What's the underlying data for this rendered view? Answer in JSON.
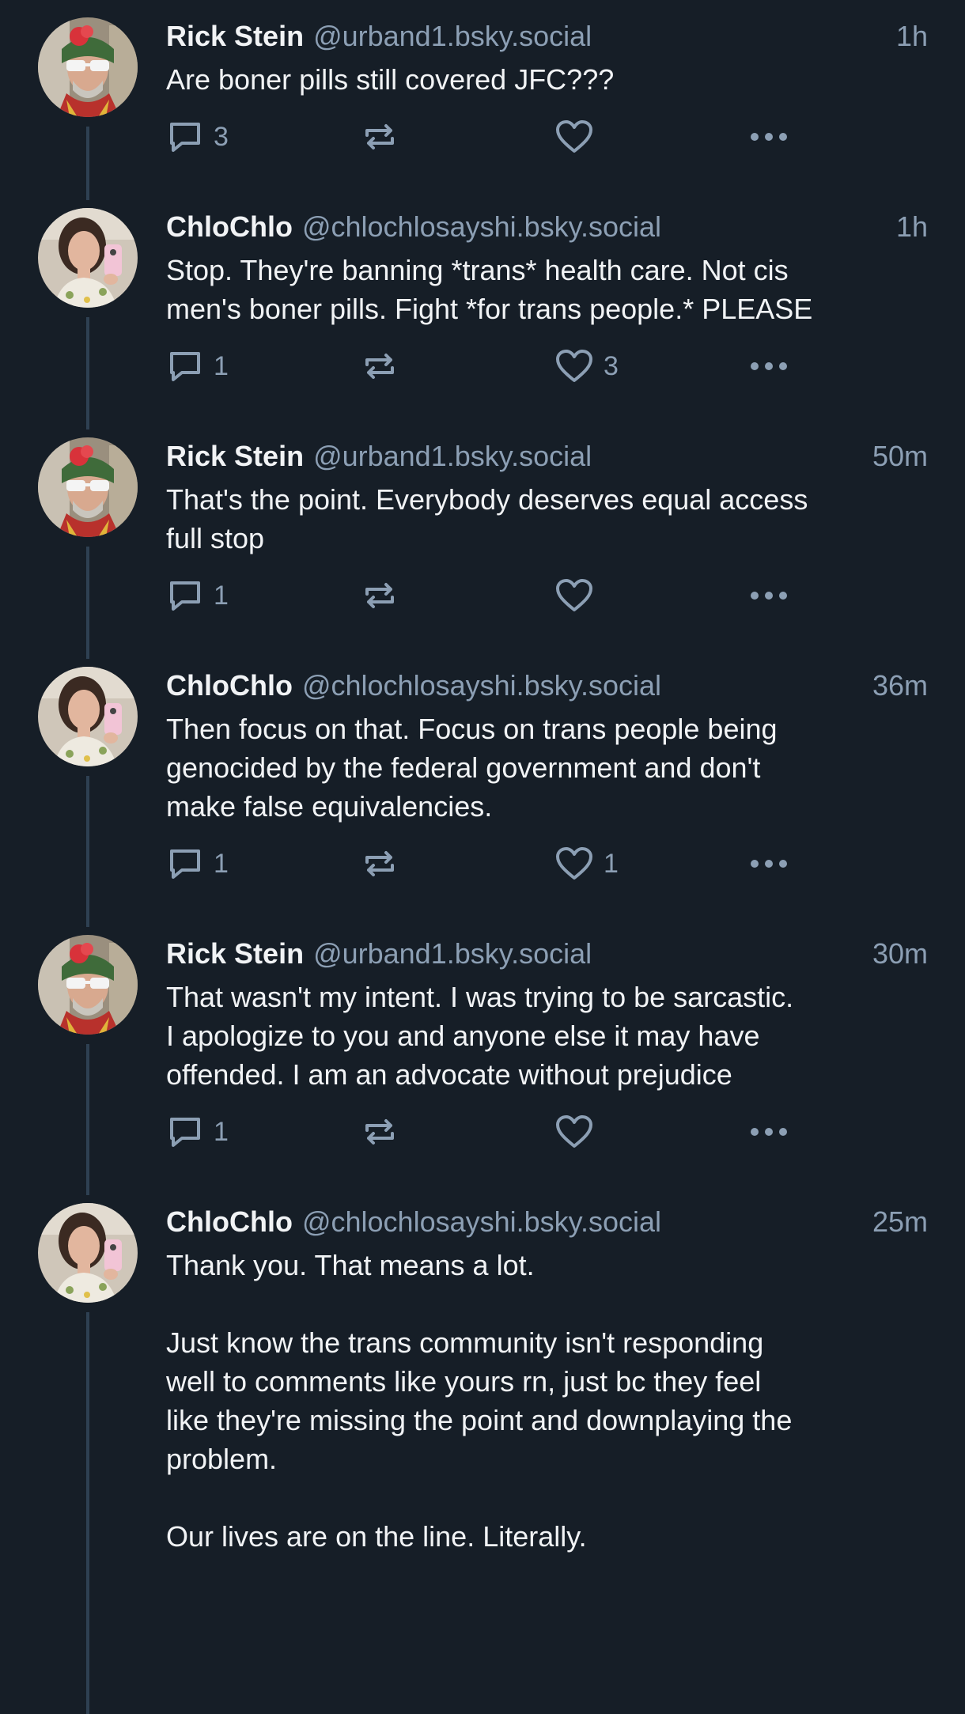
{
  "colors": {
    "background": "#161e27",
    "muted": "#8c9fb4",
    "thread_line": "#2e4052",
    "text": "#f1f3f5"
  },
  "icons": {
    "reply": "speech-bubble-icon",
    "repost": "repost-icon",
    "like": "heart-icon",
    "more": "ellipsis-icon"
  },
  "posts": [
    {
      "name": "Rick Stein",
      "handle": "@urband1.bsky.social",
      "time": "1h",
      "text": "Are boner pills still covered JFC???",
      "replies": "3",
      "likes": ""
    },
    {
      "name": "ChloChlo",
      "handle": "@chlochlosayshi.bsky.social",
      "time": "1h",
      "text": "Stop. They're banning *trans* health care. Not cis\nmen's boner pills. Fight *for trans people.* PLEASE",
      "replies": "1",
      "likes": "3"
    },
    {
      "name": "Rick Stein",
      "handle": "@urband1.bsky.social",
      "time": "50m",
      "text": "That's the point. Everybody deserves equal access\nfull stop",
      "replies": "1",
      "likes": ""
    },
    {
      "name": "ChloChlo",
      "handle": "@chlochlosayshi.bsky.social",
      "time": "36m",
      "text": "Then focus on that. Focus on trans people being\ngenocided by the federal government and don't\nmake false equivalencies.",
      "replies": "1",
      "likes": "1"
    },
    {
      "name": "Rick Stein",
      "handle": "@urband1.bsky.social",
      "time": "30m",
      "text": "That wasn't my intent. I was trying to be sarcastic.\nI apologize to you and anyone else it may have\noffended. I am an advocate without prejudice",
      "replies": "1",
      "likes": ""
    },
    {
      "name": "ChloChlo",
      "handle": "@chlochlosayshi.bsky.social",
      "time": "25m",
      "text": "Thank you. That means a lot.\n\nJust know the trans community isn't responding\nwell to comments like yours rn, just bc they feel\nlike they're missing the point and downplaying the\nproblem.\n\nOur lives are on the line. Literally.",
      "replies": "",
      "likes": ""
    }
  ]
}
